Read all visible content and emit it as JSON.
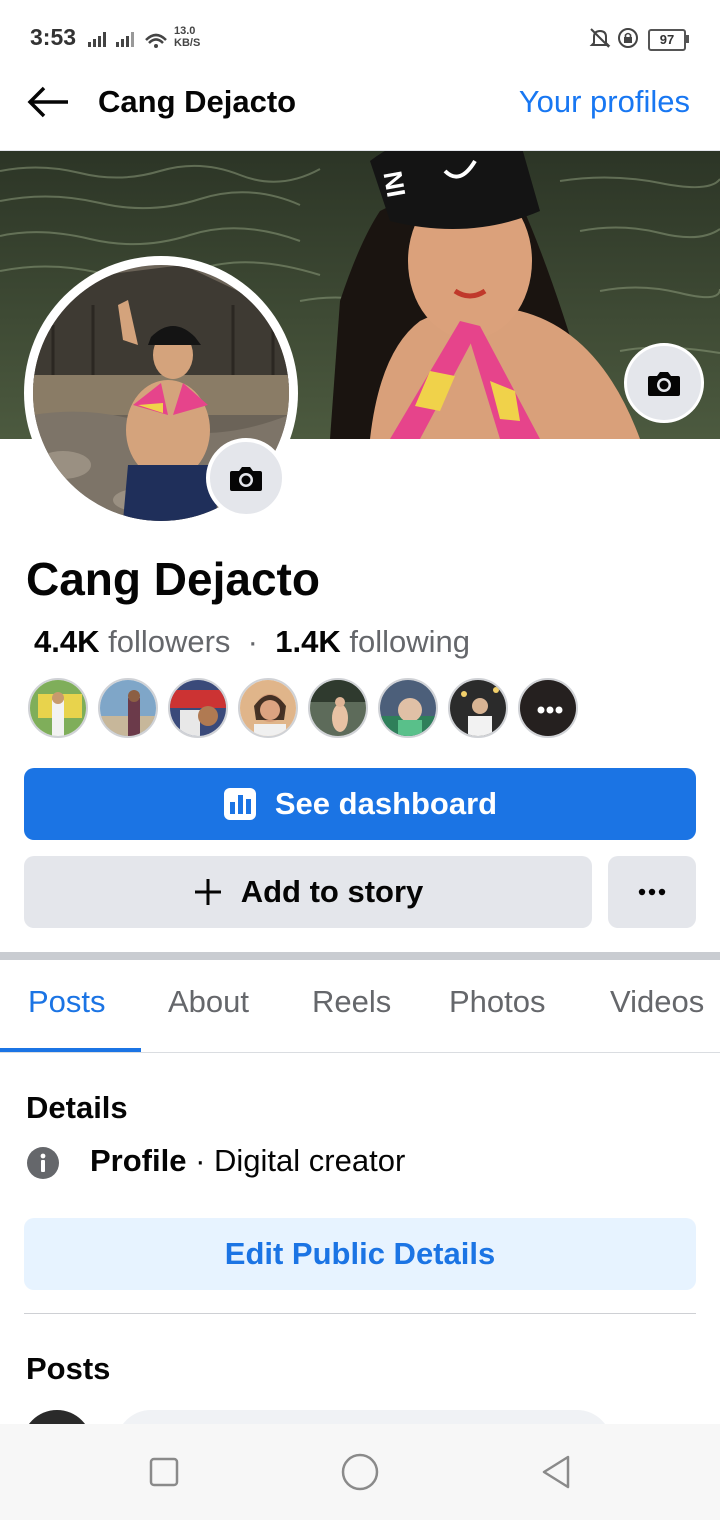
{
  "status": {
    "time": "3:53",
    "speed_value": "13.0",
    "speed_unit": "KB/S",
    "battery": "97"
  },
  "header": {
    "title": "Cang Dejacto",
    "link": "Your profiles",
    "back_icon": "arrow-left-icon"
  },
  "profile": {
    "name": "Cang Dejacto",
    "followers_count": "4.4K",
    "followers_label": "followers",
    "following_count": "1.4K",
    "following_label": "following",
    "cover_camera_icon": "camera-icon",
    "avatar_camera_icon": "camera-icon"
  },
  "followers_preview": {
    "count_shown": 7,
    "more_icon": "ellipsis-icon"
  },
  "buttons": {
    "dashboard": "See dashboard",
    "dashboard_icon": "bar-chart-icon",
    "add_story": "Add to story",
    "add_story_icon": "plus-icon",
    "more_icon": "ellipsis-icon",
    "edit_details": "Edit Public Details"
  },
  "tabs": [
    "Posts",
    "About",
    "Reels",
    "Photos",
    "Videos"
  ],
  "active_tab": "Posts",
  "details": {
    "title": "Details",
    "row_icon": "info-icon",
    "row_bold": "Profile",
    "row_sep": " · ",
    "row_value": "Digital creator"
  },
  "posts": {
    "title": "Posts"
  },
  "colors": {
    "accent": "#1b74e4",
    "link": "#1877f2",
    "secondary_text": "#65676b",
    "button_grey": "#e4e6eb",
    "light_blue": "#e7f3ff"
  },
  "navbar": {
    "icons": [
      "recents-square-icon",
      "home-circle-icon",
      "back-triangle-icon"
    ]
  }
}
